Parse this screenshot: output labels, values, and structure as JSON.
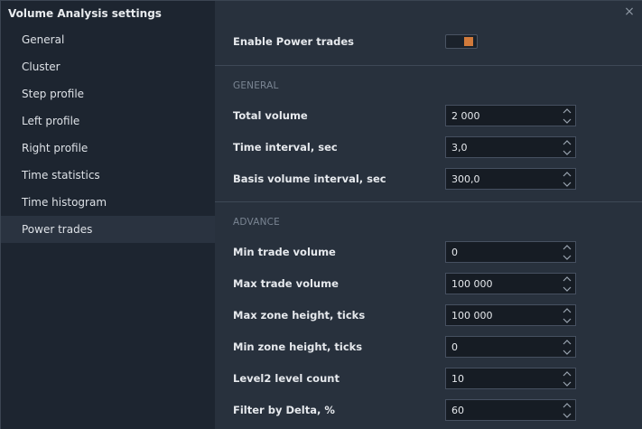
{
  "window": {
    "title": "Volume Analysis settings",
    "close_label": "×"
  },
  "sidebar": {
    "items": [
      {
        "label": "General"
      },
      {
        "label": "Cluster"
      },
      {
        "label": "Step profile"
      },
      {
        "label": "Left profile"
      },
      {
        "label": "Right profile"
      },
      {
        "label": "Time statistics"
      },
      {
        "label": "Time histogram"
      },
      {
        "label": "Power trades"
      }
    ],
    "active_index": 7
  },
  "main": {
    "enable": {
      "label": "Enable Power trades",
      "enabled": true
    },
    "general": {
      "title": "GENERAL",
      "fields": [
        {
          "label": "Total volume",
          "value": "2 000"
        },
        {
          "label": "Time interval, sec",
          "value": "3,0"
        },
        {
          "label": "Basis volume interval, sec",
          "value": "300,0"
        }
      ]
    },
    "advance": {
      "title": "ADVANCE",
      "fields": [
        {
          "label": "Min trade volume",
          "value": "0"
        },
        {
          "label": "Max trade volume",
          "value": "100 000"
        },
        {
          "label": "Max zone height, ticks",
          "value": "100 000"
        },
        {
          "label": "Min zone height, ticks",
          "value": "0"
        },
        {
          "label": "Level2 level count",
          "value": "10"
        },
        {
          "label": "Filter by Delta, %",
          "value": "60"
        }
      ]
    }
  },
  "colors": {
    "accent": "#d17a3b",
    "sidebar_bg": "#1d2530",
    "panel_bg": "#28313d",
    "input_bg": "#161c24"
  },
  "icons": {
    "close": "close-icon",
    "up": "chevron-up-icon",
    "down": "chevron-down-icon"
  }
}
